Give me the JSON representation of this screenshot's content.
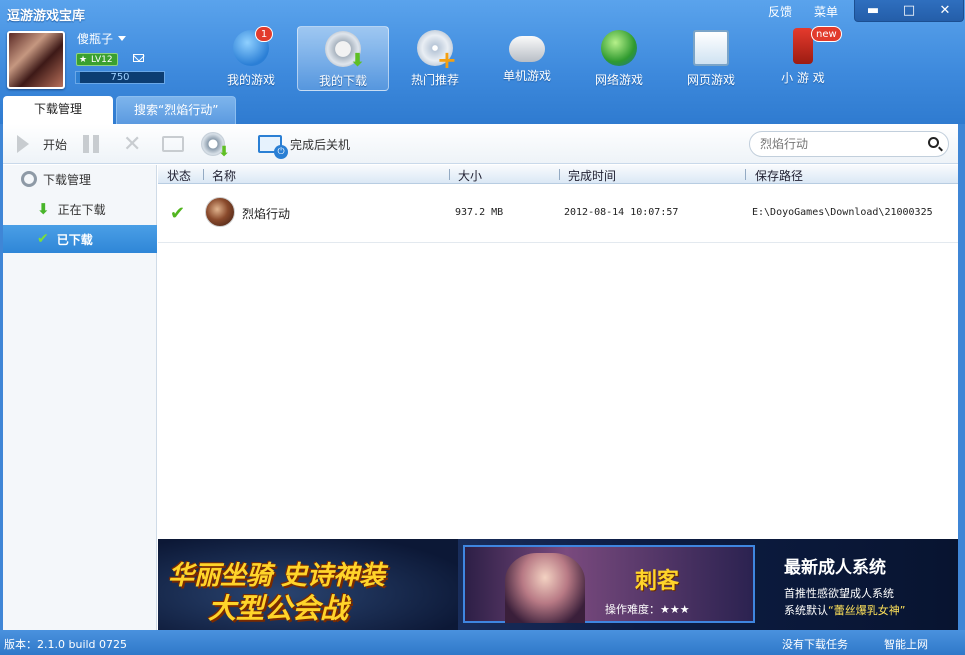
{
  "app": {
    "title": "逗游游戏宝库"
  },
  "title_links": [
    "反馈",
    "菜单"
  ],
  "window_controls": [
    "▬",
    "□",
    "✕"
  ],
  "user": {
    "name": "傻瓶子",
    "level": "LV12",
    "exp": "750",
    "exp_fraction": 0.05
  },
  "nav": [
    {
      "label": "我的游戏",
      "icon": "people-icon",
      "badge": "1"
    },
    {
      "label": "我的下载",
      "icon": "gear-download-icon",
      "badge": ""
    },
    {
      "label": "热门推荐",
      "icon": "disc-plus-icon",
      "badge": ""
    },
    {
      "label": "单机游戏",
      "icon": "gamepad-icon",
      "badge": ""
    },
    {
      "label": "网络游戏",
      "icon": "globe-sword-icon",
      "badge": ""
    },
    {
      "label": "网页游戏",
      "icon": "webpage-icon",
      "badge": ""
    },
    {
      "label": "小 游 戏",
      "icon": "joystick-icon",
      "badge": "new"
    }
  ],
  "tabs": [
    {
      "label": "下载管理",
      "active": true
    },
    {
      "label": "搜索“烈焰行动”",
      "active": false
    }
  ],
  "toolbar": {
    "start_label": "开始",
    "shutdown_label": "完成后关机"
  },
  "search": {
    "placeholder": "烈焰行动"
  },
  "sidebar": {
    "root": "下载管理",
    "items": [
      {
        "label": "正在下载",
        "icon": "download-arrow-icon"
      },
      {
        "label": "已下载",
        "icon": "check-icon",
        "selected": true
      }
    ]
  },
  "table": {
    "columns": [
      "状态",
      "名称",
      "大小",
      "完成时间",
      "保存路径"
    ],
    "rows": [
      {
        "status": "✔",
        "name": "烈焰行动",
        "size": "937.2 MB",
        "time": "2012-08-14 10:07:57",
        "path": "E:\\DoyoGames\\Download\\21000325"
      }
    ]
  },
  "banner": {
    "left_line1": "华丽坐骑 史诗神装",
    "left_line2": "大型公会战",
    "mid_title": "刺客",
    "mid_sub": "操作难度：★★★",
    "right_title": "最新成人系统",
    "right_line1": "首推性感欲望成人系统",
    "right_line2_prefix": "系统默认",
    "right_line2_highlight": "“蕾丝爆乳女神”"
  },
  "status": {
    "version": "版本：2.1.0 build 0725",
    "no_download": "没有下载任务",
    "smart_net": "智能上网"
  }
}
